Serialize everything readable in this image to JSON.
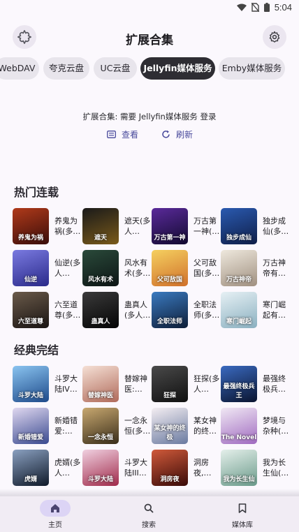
{
  "status_bar": {
    "time": "5:04",
    "icons": [
      "wifi-icon",
      "sim-card-off-icon",
      "battery-icon"
    ]
  },
  "app_bar": {
    "title": "扩展合集",
    "left_icon": "extension-puzzle-icon",
    "right_icon": "gear-icon"
  },
  "tabs": [
    {
      "label": "WebDAV",
      "active": false
    },
    {
      "label": "夸克云盘",
      "active": false
    },
    {
      "label": "UC云盘",
      "active": false
    },
    {
      "label": "Jellyfin媒体服务",
      "active": true
    },
    {
      "label": "Emby媒体服务",
      "active": false
    }
  ],
  "notice": "扩展合集: 需要 Jellyfin媒体服务 登录",
  "actions": {
    "view_label": "查看",
    "refresh_label": "刷新"
  },
  "sections": [
    {
      "title": "热门连载",
      "items": [
        {
          "name": "养鬼为祸(多…",
          "cover_text": "养鬼为祸",
          "cover_color": "#6b1f16"
        },
        {
          "name": "遮天(多人…",
          "cover_text": "遮天",
          "cover_color": "#3b2a12"
        },
        {
          "name": "万古第一神(…",
          "cover_text": "万古第一神",
          "cover_color": "#241a4a"
        },
        {
          "name": "独步成仙(多…",
          "cover_text": "独步成仙",
          "cover_color": "#1d3a78"
        },
        {
          "name": "仙逆(多人…",
          "cover_text": "仙逆",
          "cover_color": "#3a3d9c"
        },
        {
          "name": "风水有术(多…",
          "cover_text": "风水有术",
          "cover_color": "#1f2a2a"
        },
        {
          "name": "父可敌国(多…",
          "cover_text": "父可敌国",
          "cover_color": "#e8b23a"
        },
        {
          "name": "万古神帝有…",
          "cover_text": "万古神帝",
          "cover_color": "#c9c0b4"
        },
        {
          "name": "六至道尊(多…",
          "cover_text": "六至道尊",
          "cover_color": "#3a3530"
        },
        {
          "name": "蛊真人(多人…",
          "cover_text": "蛊真人",
          "cover_color": "#1a1a1a"
        },
        {
          "name": "全职法师(多…",
          "cover_text": "全职法师",
          "cover_color": "#1e3f6b"
        },
        {
          "name": "寒门崛起有…",
          "cover_text": "寒门崛起",
          "cover_color": "#c8d8e0"
        }
      ]
    },
    {
      "title": "经典完结",
      "items": [
        {
          "name": "斗罗大陆IV…",
          "cover_text": "斗罗大陆",
          "cover_color": "#3c7fc4"
        },
        {
          "name": "替嫁神医:…",
          "cover_text": "替嫁神医",
          "cover_color": "#d9a9a0"
        },
        {
          "name": "狂探(多人…",
          "cover_text": "狂探",
          "cover_color": "#2a2a2a"
        },
        {
          "name": "最强终极兵…",
          "cover_text": "最强终极兵王",
          "cover_color": "#1e2f5a"
        },
        {
          "name": "新婚错爱:…",
          "cover_text": "新婚错爱",
          "cover_color": "#4a5ba0"
        },
        {
          "name": "一念永恒(多…",
          "cover_text": "一念永恒",
          "cover_color": "#6b5a3a"
        },
        {
          "name": "某女神的终…",
          "cover_text": "某女神的终极",
          "cover_color": "#e0d0d8"
        },
        {
          "name": "梦境与杂种(…",
          "cover_text": "The Novel",
          "cover_color": "#c48fc8"
        },
        {
          "name": "虎婿(多人…",
          "cover_text": "虎婿",
          "cover_color": "#2a3a5a"
        },
        {
          "name": "斗罗大陆III…",
          "cover_text": "斗罗大陆",
          "cover_color": "#c03a5a"
        },
        {
          "name": "洞房夜,…",
          "cover_text": "洞房夜",
          "cover_color": "#8a2a22"
        },
        {
          "name": "我为长生仙(…",
          "cover_text": "我为长生仙",
          "cover_color": "#9ab8b0"
        }
      ]
    }
  ],
  "bottom_nav": [
    {
      "label": "主页",
      "icon": "home-icon",
      "active": true
    },
    {
      "label": "搜索",
      "icon": "search-icon",
      "active": false
    },
    {
      "label": "媒体库",
      "icon": "bookmark-icon",
      "active": false
    }
  ]
}
